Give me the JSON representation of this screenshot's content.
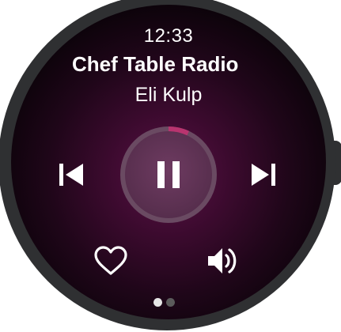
{
  "status": {
    "time": "12:33"
  },
  "now_playing": {
    "title": "Chef Table Radio",
    "artist": "Eli Kulp",
    "progress": 0.07
  },
  "controls": {
    "previous_icon": "skip-previous-icon",
    "play_pause_icon": "pause-icon",
    "next_icon": "skip-next-icon",
    "favorite_icon": "heart-outline-icon",
    "volume_icon": "volume-icon"
  },
  "pager": {
    "page_count": 2,
    "current_page": 1
  },
  "colors": {
    "accent": "#b8346f",
    "ring_track": "#6a4a62",
    "background": "#2f0b26",
    "bezel": "#2f3032"
  }
}
